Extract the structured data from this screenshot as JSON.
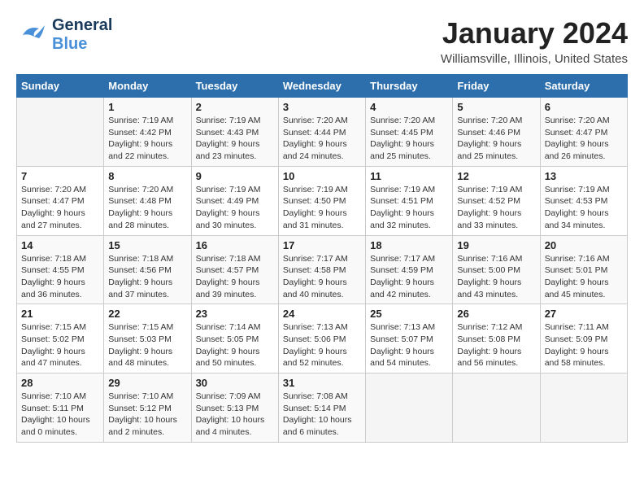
{
  "header": {
    "logo_general": "General",
    "logo_blue": "Blue",
    "month": "January 2024",
    "location": "Williamsville, Illinois, United States"
  },
  "calendar": {
    "days_of_week": [
      "Sunday",
      "Monday",
      "Tuesday",
      "Wednesday",
      "Thursday",
      "Friday",
      "Saturday"
    ],
    "weeks": [
      [
        {
          "day": "",
          "info": ""
        },
        {
          "day": "1",
          "info": "Sunrise: 7:19 AM\nSunset: 4:42 PM\nDaylight: 9 hours\nand 22 minutes."
        },
        {
          "day": "2",
          "info": "Sunrise: 7:19 AM\nSunset: 4:43 PM\nDaylight: 9 hours\nand 23 minutes."
        },
        {
          "day": "3",
          "info": "Sunrise: 7:20 AM\nSunset: 4:44 PM\nDaylight: 9 hours\nand 24 minutes."
        },
        {
          "day": "4",
          "info": "Sunrise: 7:20 AM\nSunset: 4:45 PM\nDaylight: 9 hours\nand 25 minutes."
        },
        {
          "day": "5",
          "info": "Sunrise: 7:20 AM\nSunset: 4:46 PM\nDaylight: 9 hours\nand 25 minutes."
        },
        {
          "day": "6",
          "info": "Sunrise: 7:20 AM\nSunset: 4:47 PM\nDaylight: 9 hours\nand 26 minutes."
        }
      ],
      [
        {
          "day": "7",
          "info": "Sunrise: 7:20 AM\nSunset: 4:47 PM\nDaylight: 9 hours\nand 27 minutes."
        },
        {
          "day": "8",
          "info": "Sunrise: 7:20 AM\nSunset: 4:48 PM\nDaylight: 9 hours\nand 28 minutes."
        },
        {
          "day": "9",
          "info": "Sunrise: 7:19 AM\nSunset: 4:49 PM\nDaylight: 9 hours\nand 30 minutes."
        },
        {
          "day": "10",
          "info": "Sunrise: 7:19 AM\nSunset: 4:50 PM\nDaylight: 9 hours\nand 31 minutes."
        },
        {
          "day": "11",
          "info": "Sunrise: 7:19 AM\nSunset: 4:51 PM\nDaylight: 9 hours\nand 32 minutes."
        },
        {
          "day": "12",
          "info": "Sunrise: 7:19 AM\nSunset: 4:52 PM\nDaylight: 9 hours\nand 33 minutes."
        },
        {
          "day": "13",
          "info": "Sunrise: 7:19 AM\nSunset: 4:53 PM\nDaylight: 9 hours\nand 34 minutes."
        }
      ],
      [
        {
          "day": "14",
          "info": "Sunrise: 7:18 AM\nSunset: 4:55 PM\nDaylight: 9 hours\nand 36 minutes."
        },
        {
          "day": "15",
          "info": "Sunrise: 7:18 AM\nSunset: 4:56 PM\nDaylight: 9 hours\nand 37 minutes."
        },
        {
          "day": "16",
          "info": "Sunrise: 7:18 AM\nSunset: 4:57 PM\nDaylight: 9 hours\nand 39 minutes."
        },
        {
          "day": "17",
          "info": "Sunrise: 7:17 AM\nSunset: 4:58 PM\nDaylight: 9 hours\nand 40 minutes."
        },
        {
          "day": "18",
          "info": "Sunrise: 7:17 AM\nSunset: 4:59 PM\nDaylight: 9 hours\nand 42 minutes."
        },
        {
          "day": "19",
          "info": "Sunrise: 7:16 AM\nSunset: 5:00 PM\nDaylight: 9 hours\nand 43 minutes."
        },
        {
          "day": "20",
          "info": "Sunrise: 7:16 AM\nSunset: 5:01 PM\nDaylight: 9 hours\nand 45 minutes."
        }
      ],
      [
        {
          "day": "21",
          "info": "Sunrise: 7:15 AM\nSunset: 5:02 PM\nDaylight: 9 hours\nand 47 minutes."
        },
        {
          "day": "22",
          "info": "Sunrise: 7:15 AM\nSunset: 5:03 PM\nDaylight: 9 hours\nand 48 minutes."
        },
        {
          "day": "23",
          "info": "Sunrise: 7:14 AM\nSunset: 5:05 PM\nDaylight: 9 hours\nand 50 minutes."
        },
        {
          "day": "24",
          "info": "Sunrise: 7:13 AM\nSunset: 5:06 PM\nDaylight: 9 hours\nand 52 minutes."
        },
        {
          "day": "25",
          "info": "Sunrise: 7:13 AM\nSunset: 5:07 PM\nDaylight: 9 hours\nand 54 minutes."
        },
        {
          "day": "26",
          "info": "Sunrise: 7:12 AM\nSunset: 5:08 PM\nDaylight: 9 hours\nand 56 minutes."
        },
        {
          "day": "27",
          "info": "Sunrise: 7:11 AM\nSunset: 5:09 PM\nDaylight: 9 hours\nand 58 minutes."
        }
      ],
      [
        {
          "day": "28",
          "info": "Sunrise: 7:10 AM\nSunset: 5:11 PM\nDaylight: 10 hours\nand 0 minutes."
        },
        {
          "day": "29",
          "info": "Sunrise: 7:10 AM\nSunset: 5:12 PM\nDaylight: 10 hours\nand 2 minutes."
        },
        {
          "day": "30",
          "info": "Sunrise: 7:09 AM\nSunset: 5:13 PM\nDaylight: 10 hours\nand 4 minutes."
        },
        {
          "day": "31",
          "info": "Sunrise: 7:08 AM\nSunset: 5:14 PM\nDaylight: 10 hours\nand 6 minutes."
        },
        {
          "day": "",
          "info": ""
        },
        {
          "day": "",
          "info": ""
        },
        {
          "day": "",
          "info": ""
        }
      ]
    ]
  }
}
